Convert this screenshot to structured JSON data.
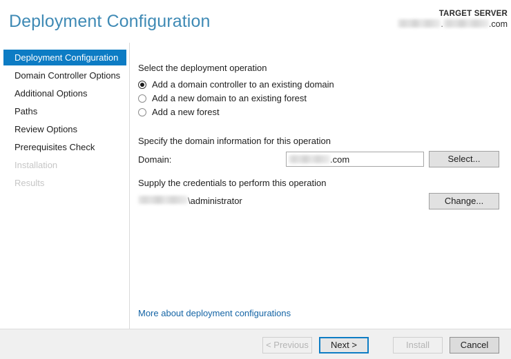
{
  "header": {
    "title": "Deployment Configuration",
    "target_server_label": "TARGET SERVER",
    "target_server_redacted_1": " ",
    "target_server_separator": ".",
    "target_server_redacted_2": " ",
    "target_server_suffix": ".com"
  },
  "sidebar": {
    "items": [
      {
        "label": "Deployment Configuration",
        "state": "selected"
      },
      {
        "label": "Domain Controller Options",
        "state": "enabled"
      },
      {
        "label": "Additional Options",
        "state": "enabled"
      },
      {
        "label": "Paths",
        "state": "enabled"
      },
      {
        "label": "Review Options",
        "state": "enabled"
      },
      {
        "label": "Prerequisites Check",
        "state": "enabled"
      },
      {
        "label": "Installation",
        "state": "disabled"
      },
      {
        "label": "Results",
        "state": "disabled"
      }
    ]
  },
  "main": {
    "operation_section_label": "Select the deployment operation",
    "operations": [
      {
        "label": "Add a domain controller to an existing domain",
        "checked": true
      },
      {
        "label": "Add a new domain to an existing forest",
        "checked": false
      },
      {
        "label": "Add a new forest",
        "checked": false
      }
    ],
    "domain_section_label": "Specify the domain information for this operation",
    "domain_field_label": "Domain:",
    "domain_value_redacted": " ",
    "domain_value_suffix": ".com",
    "select_button_label": "Select...",
    "credentials_section_label": "Supply the credentials to perform this operation",
    "credentials_domain_redacted": " ",
    "credentials_account": "\\administrator",
    "change_button_label": "Change...",
    "more_link_label": "More about deployment configurations"
  },
  "footer": {
    "previous_label": "< Previous",
    "next_label": "Next >",
    "install_label": "Install",
    "cancel_label": "Cancel"
  },
  "colors": {
    "accent_blue": "#0d7cc4",
    "title_blue": "#3f8ab5",
    "link_blue": "#1464a5",
    "footer_bg": "#f0f0f0",
    "disabled_text": "#c6c6c6"
  }
}
